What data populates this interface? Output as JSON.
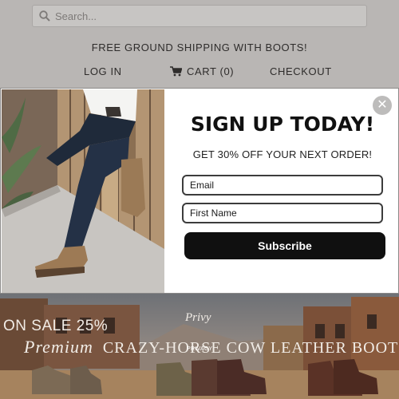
{
  "search": {
    "placeholder": "Search..."
  },
  "header": {
    "promo": "FREE GROUND SHIPPING WITH BOOTS!",
    "nav": {
      "login": "LOG IN",
      "cart": "CART (0)",
      "checkout": "CHECKOUT"
    }
  },
  "modal": {
    "close_label": "✕",
    "heading": "SIGN UP TODAY!",
    "subheading": "GET 30% OFF YOUR NEXT ORDER!",
    "email_placeholder": "Email",
    "first_name_placeholder": "First Name",
    "subscribe_label": "Subscribe"
  },
  "hero": {
    "sale_text": "ON SALE 25%",
    "title_script": "Premium",
    "title_main": "CRAZY-HORSE COW LEATHER BOOTS",
    "logo_text": "Privy",
    "privacy_label": "PRIVACY"
  },
  "icons": {
    "search": "search-icon",
    "cart": "shopping-cart-icon",
    "close": "close-icon"
  },
  "colors": {
    "overlay_bg": "#b9b6b4",
    "modal_bg": "#ffffff",
    "subscribe_bg": "#101010",
    "close_bg": "#bdbcbb"
  }
}
